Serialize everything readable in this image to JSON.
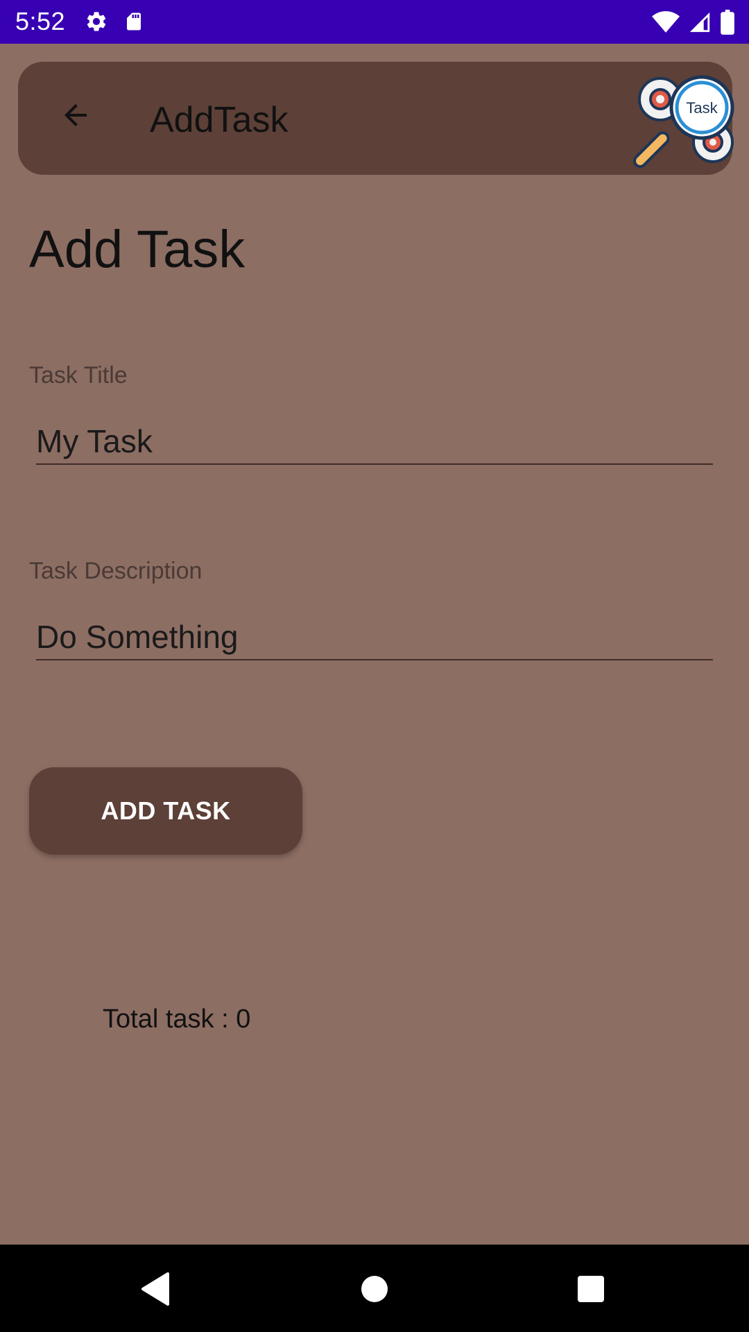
{
  "status_bar": {
    "time": "5:52",
    "icons": [
      "settings-icon",
      "sd-card-icon",
      "wifi-icon",
      "cell-signal-icon",
      "battery-icon"
    ]
  },
  "app_bar": {
    "title": "AddTask",
    "back_icon": "arrow-back-icon",
    "logo_text": "Task"
  },
  "main": {
    "heading": "Add Task",
    "task_title": {
      "label": "Task Title",
      "value": "My Task"
    },
    "task_description": {
      "label": "Task Description",
      "value": "Do Something"
    },
    "add_button_label": "ADD TASK",
    "total_text": "Total task : 0"
  },
  "nav_bar": {
    "icons": [
      "nav-back-icon",
      "nav-home-icon",
      "nav-recents-icon"
    ]
  },
  "colors": {
    "status_bar": "#3700b3",
    "background": "#8d6e63",
    "primary": "#5d4037",
    "nav_bar": "#000000"
  }
}
